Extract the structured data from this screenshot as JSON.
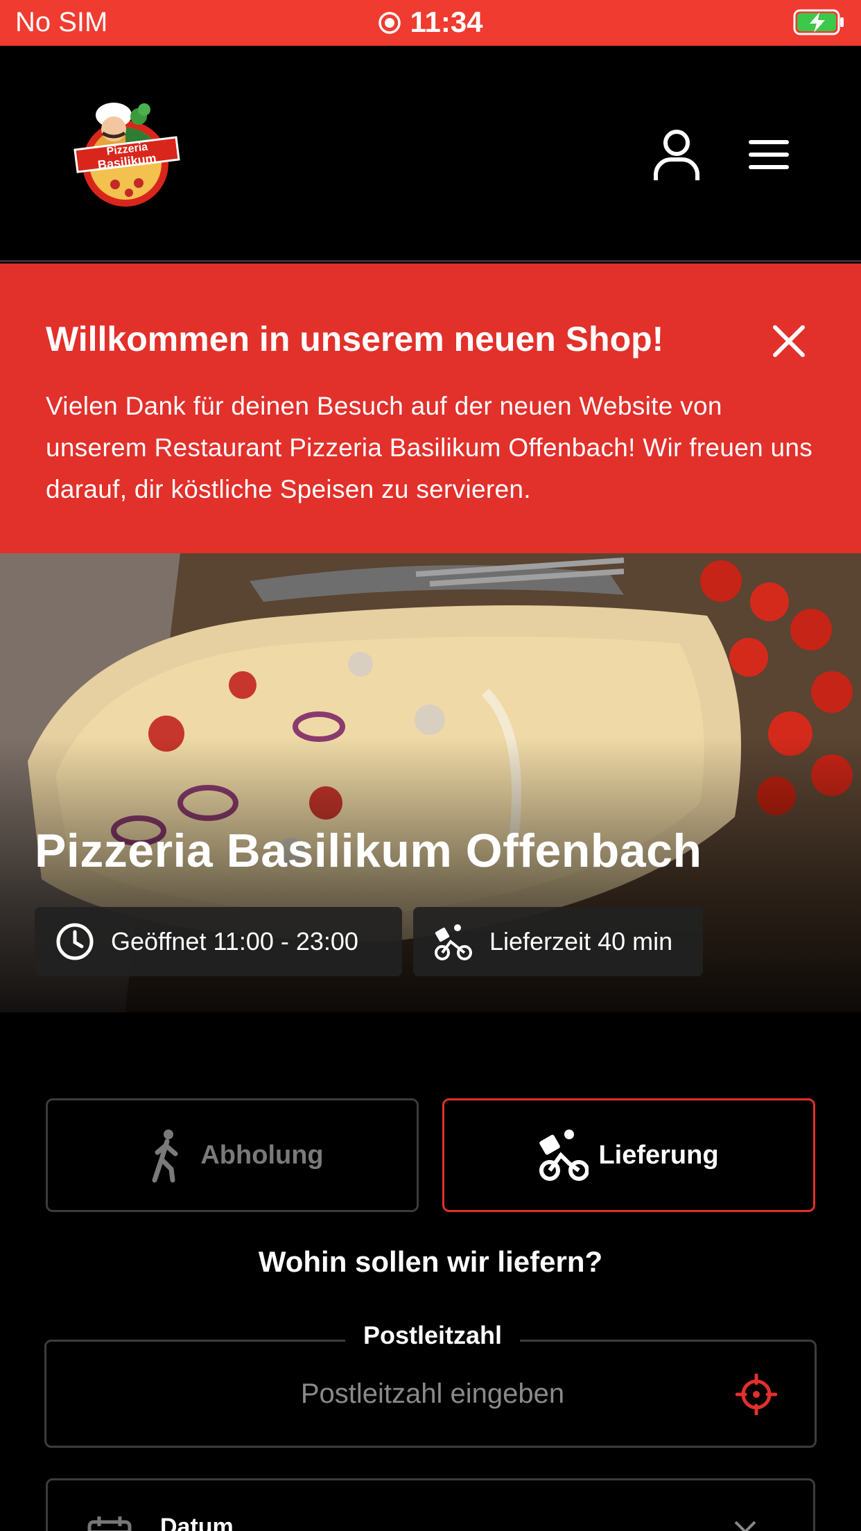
{
  "status_bar": {
    "carrier": "No SIM",
    "time": "11:34"
  },
  "header": {
    "logo_text_1": "Pizzeria",
    "logo_text_2": "Basilikum"
  },
  "banner": {
    "title": "Willkommen in unserem neuen Shop!",
    "text": "Vielen Dank für deinen Besuch auf der neuen Website von unserem Restaurant Pizzeria Basilikum Offenbach! Wir freuen uns darauf, dir köstliche Speisen zu servieren."
  },
  "hero": {
    "title": "Pizzeria Basilikum Offenbach",
    "opening": "Geöffnet 11:00 - 23:00",
    "delivery_time": "Lieferzeit 40 min"
  },
  "order": {
    "pickup_label": "Abholung",
    "delivery_label": "Lieferung",
    "question": "Wohin sollen wir liefern?",
    "zip_label": "Postleitzahl",
    "zip_placeholder": "Postleitzahl eingeben",
    "zip_value": "",
    "date_label": "Datum"
  },
  "colors": {
    "status_bar": "#f03b30",
    "banner": "#e2302b",
    "accent": "#e2302b",
    "background": "#000000"
  }
}
